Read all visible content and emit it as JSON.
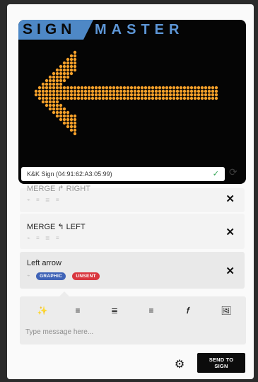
{
  "logo": {
    "left": "SIGN",
    "right": "MASTER"
  },
  "display": {
    "device_status": "K&K Sign (04:91:62:A3:05:99)",
    "status_ok": "✓",
    "refresh_glyph": "⟳",
    "led_color": "#f5a02a"
  },
  "messages": [
    {
      "title": "MERGE ↱ RIGHT",
      "tools": "⌁ ≡ ≣ ≡",
      "state": "partially-scrolled"
    },
    {
      "title": "MERGE ↰ LEFT",
      "tools": "⌁ ≡ ≣ ≡"
    },
    {
      "title": "Left arrow",
      "tools": "⌁",
      "badges": [
        "GRAPHIC",
        "UNSENT"
      ],
      "selected": true
    }
  ],
  "close_glyph": "✕",
  "composer": {
    "tools": [
      "✨",
      "≡",
      "≣",
      "≡",
      "𝑓",
      "🖼"
    ],
    "placeholder": "Type message here..."
  },
  "footer": {
    "settings_glyph": "⚙",
    "send_label": "SEND TO SIGN"
  }
}
